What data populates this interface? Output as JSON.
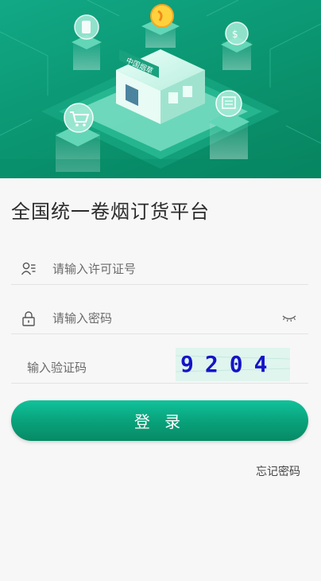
{
  "app": {
    "title": "全国统一卷烟订货平台"
  },
  "hero": {
    "sign_text": "中国烟草"
  },
  "form": {
    "license_placeholder": "请输入许可证号",
    "password_placeholder": "请输入密码",
    "captcha_placeholder": "输入验证码",
    "captcha_value": "9204",
    "login_label": "登 录",
    "forgot_password_label": "忘记密码"
  },
  "icons": {
    "license": "user-list-icon",
    "password": "lock-icon",
    "visibility": "eye-closed-icon",
    "hero_items": [
      "phone-icon",
      "coin-icon",
      "money-bag-icon",
      "shopping-cart-icon",
      "document-icon"
    ]
  },
  "colors": {
    "brand": "#08a079",
    "brand_light": "#10c29b",
    "hero_bg": "#0a946f",
    "captcha_text": "#1414c8",
    "captcha_bg": "#dff5ee",
    "background": "#f7f7f7"
  }
}
